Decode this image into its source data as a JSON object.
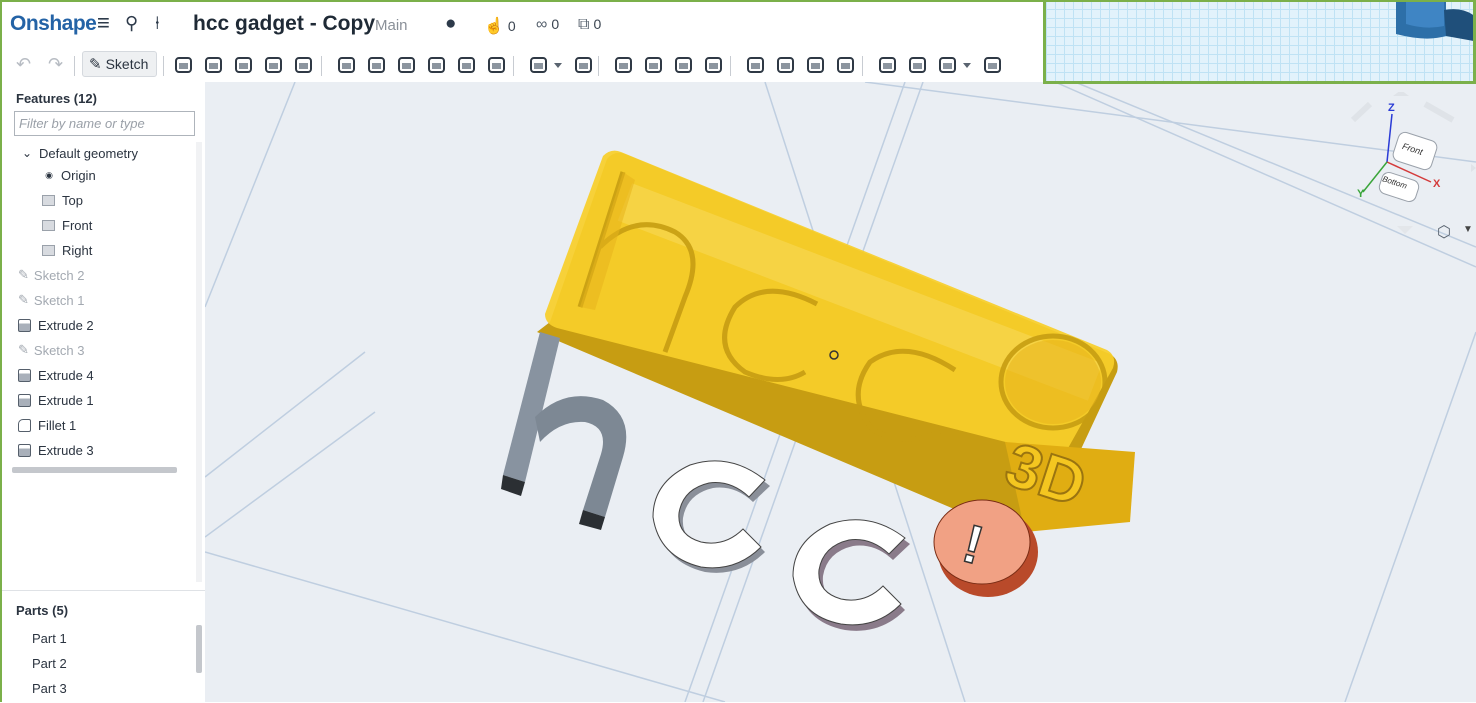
{
  "app": {
    "name": "Onshape"
  },
  "document": {
    "title": "hcc gadget - Copy",
    "branch": "Main"
  },
  "counters": {
    "likes": "0",
    "links": "0",
    "copies": "0"
  },
  "toolbar": {
    "sketch_label": "Sketch"
  },
  "features": {
    "title": "Features (12)",
    "filter_placeholder": "Filter by name or type",
    "default_geometry": "Default geometry",
    "origin": "Origin",
    "planes": [
      "Top",
      "Front",
      "Right"
    ],
    "items": [
      {
        "label": "Sketch 2",
        "kind": "sketch"
      },
      {
        "label": "Sketch 1",
        "kind": "sketch"
      },
      {
        "label": "Extrude 2",
        "kind": "extrude"
      },
      {
        "label": "Sketch 3",
        "kind": "sketch"
      },
      {
        "label": "Extrude 4",
        "kind": "extrude"
      },
      {
        "label": "Extrude 1",
        "kind": "extrude"
      },
      {
        "label": "Fillet 1",
        "kind": "fillet"
      },
      {
        "label": "Extrude 3",
        "kind": "extrude"
      }
    ]
  },
  "parts": {
    "title": "Parts (5)",
    "items": [
      "Part 1",
      "Part 2",
      "Part 3"
    ]
  },
  "viewcube": {
    "front": "Front",
    "bottom": "Bottom",
    "z": "Z",
    "x": "X",
    "y": "Y"
  },
  "model": {
    "plate_text": "hcc",
    "badge_text": "3D",
    "loose_letters": "hcc",
    "coin_symbol": "!"
  },
  "colors": {
    "brand": "#2463a6",
    "plate_yellow": "#f7cf2a",
    "letter_gray": "#7d8894",
    "letter_white": "#ffffff",
    "coin": "#f1a184",
    "frame_green": "#7bb04a"
  }
}
